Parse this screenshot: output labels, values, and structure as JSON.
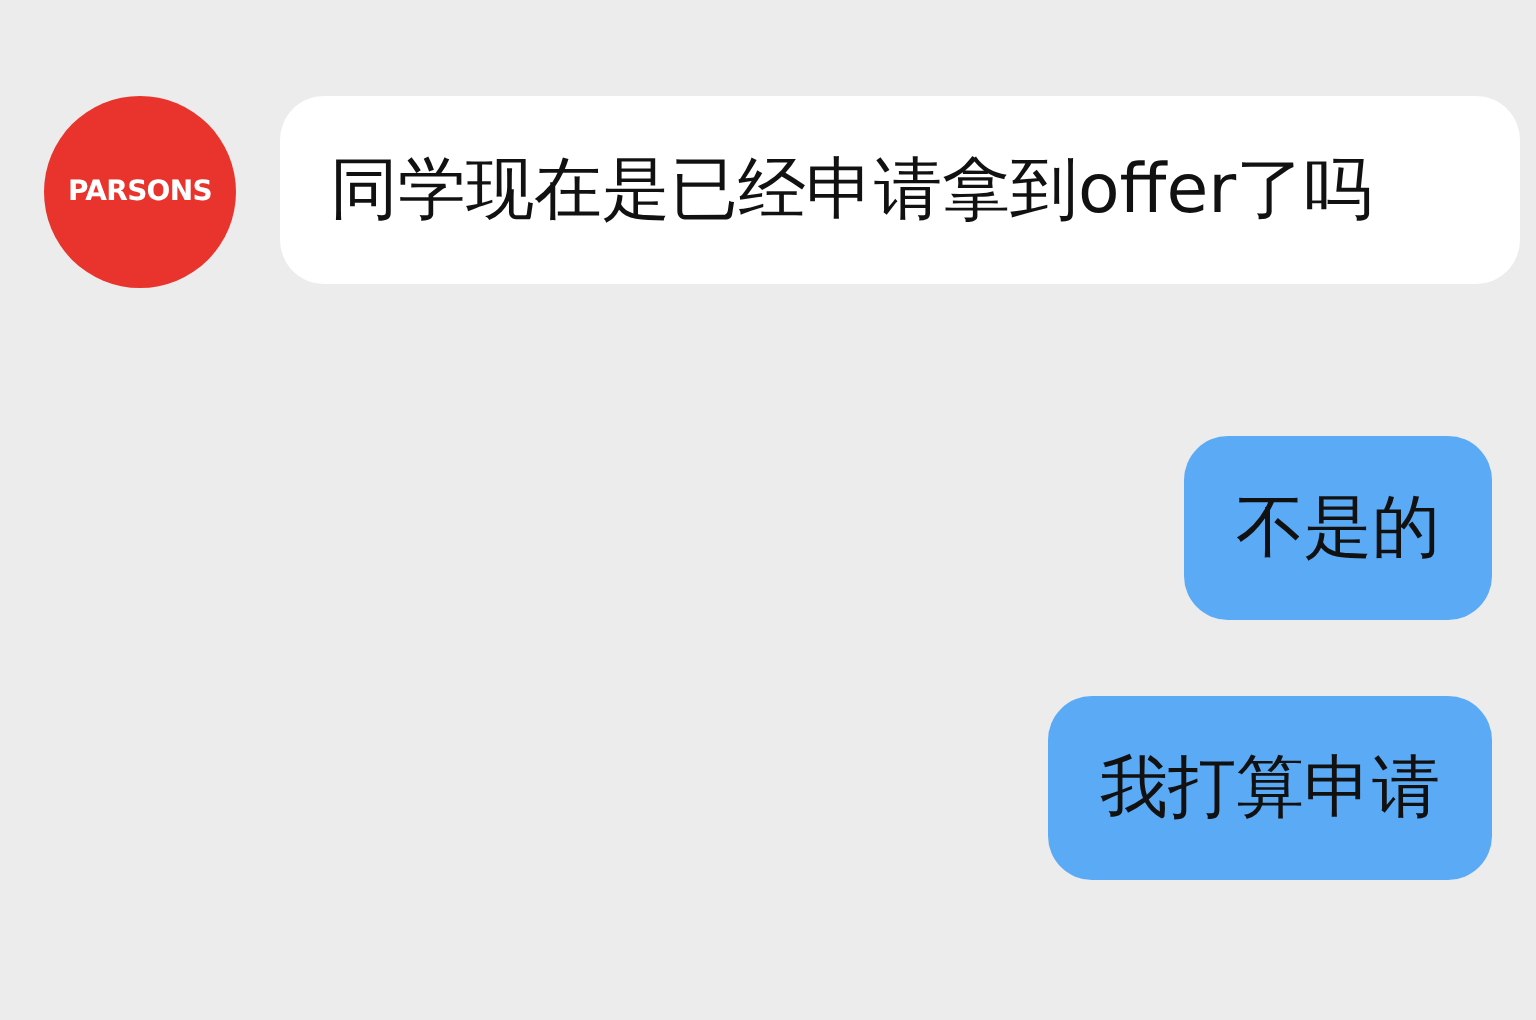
{
  "messages": [
    {
      "kind": "incoming",
      "avatar": "PARSONS",
      "text": "同学现在是已经申请拿到offer了吗"
    },
    {
      "kind": "outgoing",
      "text": "不是的"
    },
    {
      "kind": "outgoing",
      "text": "我打算申请"
    }
  ]
}
